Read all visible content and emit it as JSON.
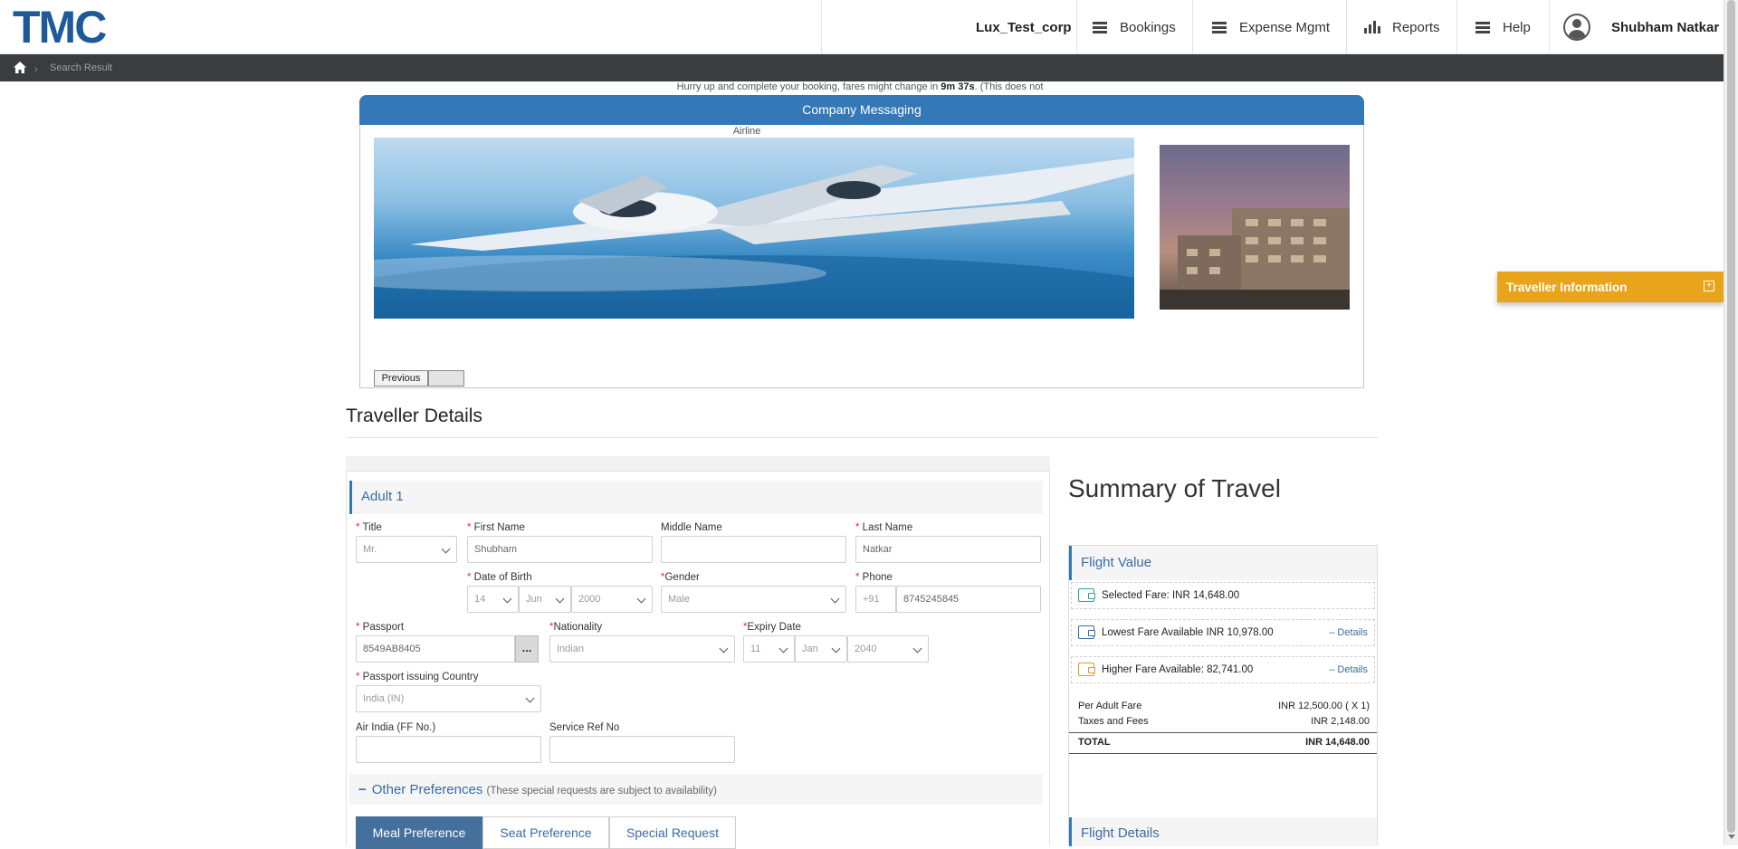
{
  "header": {
    "logo": "TMC",
    "corp": "Lux_Test_corp",
    "nav": [
      "Bookings",
      "Expense Mgmt",
      "Reports",
      "Help"
    ],
    "user_name": "Shubham Natkar"
  },
  "breadcrumb": {
    "current": "Search Result"
  },
  "notice": {
    "prefix": "Hurry up and complete your booking, fares might change in ",
    "time": "9m 37s",
    "suffix": ". (This does not"
  },
  "company_messaging": {
    "title": "Company Messaging",
    "image_label": "Airline",
    "previous_label": "Previous"
  },
  "traveller_details": {
    "title": "Traveller Details",
    "adult_title": "Adult 1",
    "labels": {
      "title": "Title",
      "first_name": "First Name",
      "middle_name": "Middle Name",
      "last_name": "Last Name",
      "dob": "Date of Birth",
      "gender": "Gender",
      "phone": "Phone",
      "passport": "Passport",
      "nationality": "Nationality",
      "expiry": "Expiry Date",
      "passport_country": "Passport issuing Country",
      "ff_no": "Air India (FF No.)",
      "service_ref": "Service Ref No"
    },
    "values": {
      "title": "Mr.",
      "first_name": "Shubham",
      "middle_name": "",
      "last_name": "Natkar",
      "dob_day": "14",
      "dob_month": "Jun",
      "dob_year": "2000",
      "gender": "Male",
      "phone_code": "+91",
      "phone": "8745245845",
      "passport": "8549AB8405",
      "passport_btn": "...",
      "nationality": "Indian",
      "exp_day": "11",
      "exp_month": "Jan",
      "exp_year": "2040",
      "passport_country": "India (IN)",
      "ff_no": "",
      "service_ref": ""
    },
    "other_prefs": {
      "toggle": "−",
      "title": "Other Preferences",
      "note": "(These special requests are subject to availability)"
    },
    "tabs": [
      "Meal Preference",
      "Seat Preference",
      "Special Request"
    ]
  },
  "summary": {
    "title": "Summary of Travel",
    "flight_value_title": "Flight Value",
    "selected_fare": "Selected Fare: INR 14,648.00",
    "lowest_fare": "Lowest Fare Available INR 10,978.00",
    "higher_fare": "Higher Fare Available: 82,741.00",
    "details_label": "– Details",
    "per_adult_label": "Per Adult Fare",
    "per_adult_value": "INR 12,500.00 ( X 1)",
    "taxes_label": "Taxes and Fees",
    "taxes_value": "INR 2,148.00",
    "total_label": "TOTAL",
    "total_value": "INR 14,648.00",
    "flight_details_title": "Flight Details"
  },
  "traveller_info_widget": {
    "label": "Traveller Information",
    "toggle": "+"
  },
  "colors": {
    "brand": "#1e5a99",
    "header_blue": "#3478b8",
    "accent_gold": "#e8a51b",
    "tab_active": "#45709b"
  }
}
